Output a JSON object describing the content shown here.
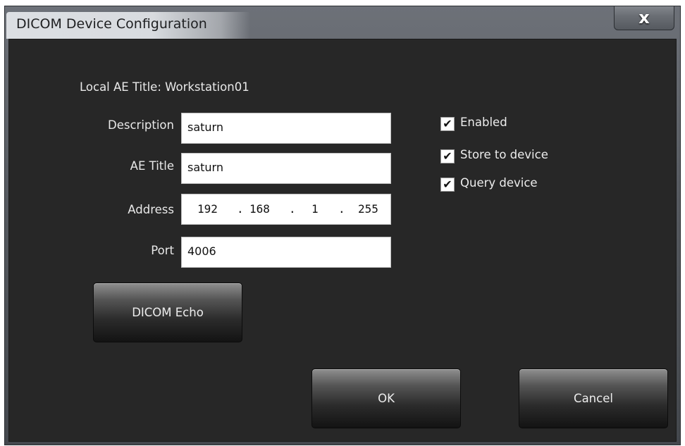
{
  "window": {
    "title": "DICOM Device Configuration",
    "close_label": "x"
  },
  "form": {
    "local_ae_title": "Local AE Title: Workstation01",
    "description": {
      "label": "Description",
      "value": "saturn"
    },
    "ae_title": {
      "label": "AE Title",
      "value": "saturn"
    },
    "address": {
      "label": "Address",
      "octets": [
        "192",
        "168",
        "1",
        "255"
      ],
      "separator": "."
    },
    "port": {
      "label": "Port",
      "value": "4006"
    }
  },
  "options": [
    {
      "label": "Enabled",
      "checked": true
    },
    {
      "label": "Store to device",
      "checked": true
    },
    {
      "label": "Query device",
      "checked": true
    }
  ],
  "checkmark": "✔",
  "buttons": {
    "echo": "DICOM Echo",
    "ok": "OK",
    "cancel": "Cancel"
  },
  "icons": {
    "close": "close-icon",
    "check": "checkmark-icon"
  }
}
